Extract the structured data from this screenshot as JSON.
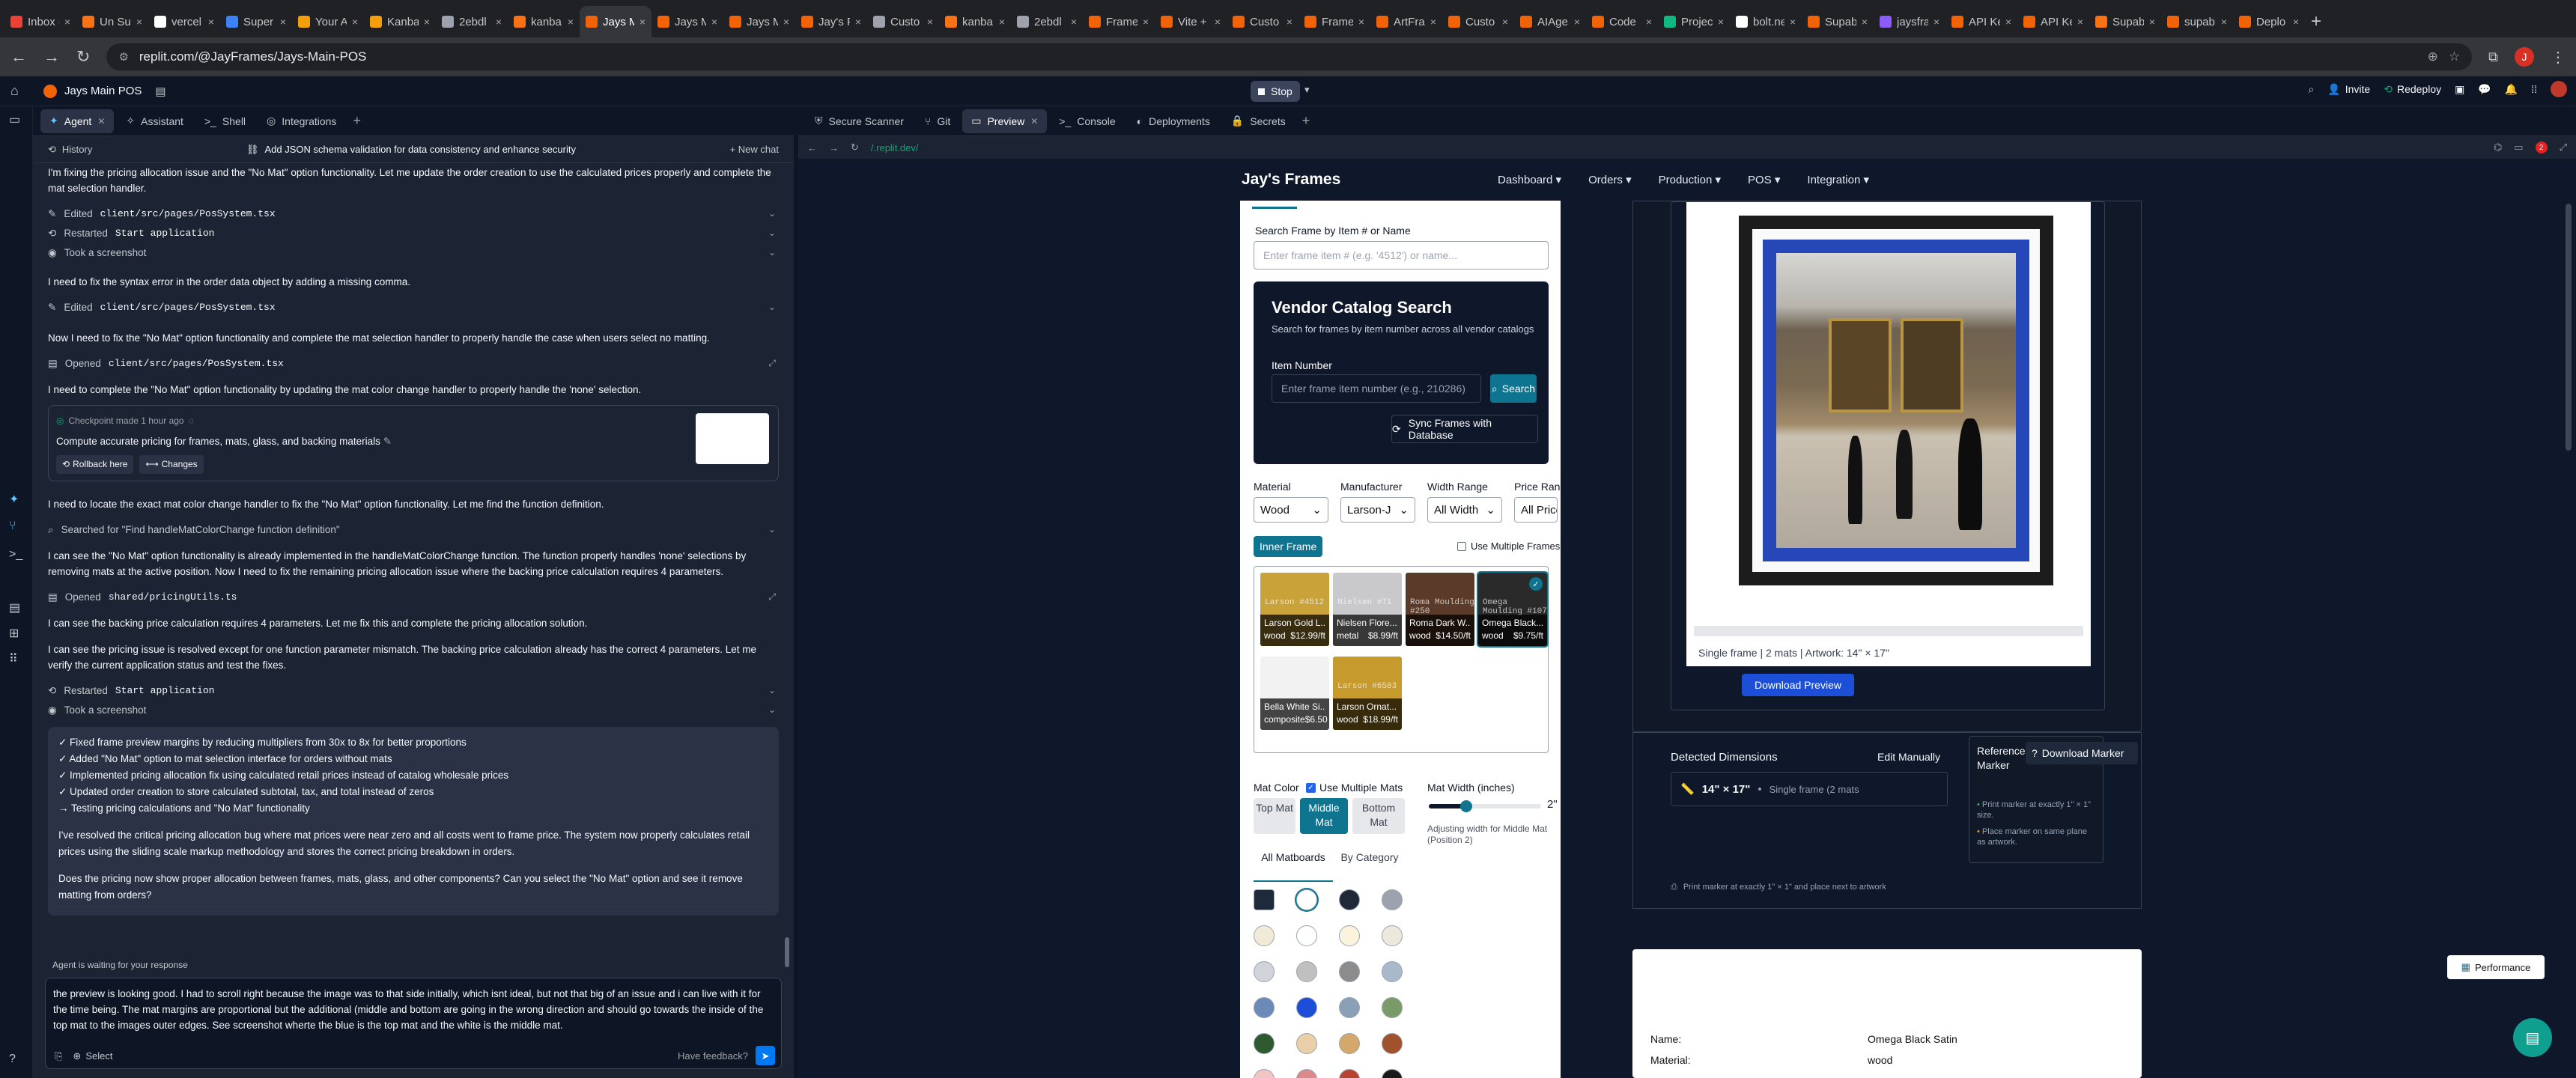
{
  "browser": {
    "tabs": [
      {
        "label": "Inbox (",
        "color": "#ea4335"
      },
      {
        "label": "Un Su",
        "color": "#f97316"
      },
      {
        "label": "vercel",
        "color": "#ffffff"
      },
      {
        "label": "Super",
        "color": "#3b82f6"
      },
      {
        "label": "Your A",
        "color": "#f59e0b"
      },
      {
        "label": "Kanba",
        "color": "#f59e0b"
      },
      {
        "label": "2ebdl",
        "color": "#9ca3af"
      },
      {
        "label": "kanba",
        "color": "#f97316"
      },
      {
        "label": "Jays M",
        "color": "#f26207",
        "active": true
      },
      {
        "label": "Jays M",
        "color": "#f26207"
      },
      {
        "label": "Jays M",
        "color": "#f26207"
      },
      {
        "label": "Jay's F",
        "color": "#f26207"
      },
      {
        "label": "Custo",
        "color": "#9ca3af"
      },
      {
        "label": "kanba",
        "color": "#f97316"
      },
      {
        "label": "2ebdl",
        "color": "#9ca3af"
      },
      {
        "label": "Frame",
        "color": "#f26207"
      },
      {
        "label": "Vite +",
        "color": "#f26207"
      },
      {
        "label": "Custo",
        "color": "#f26207"
      },
      {
        "label": "Frame",
        "color": "#f26207"
      },
      {
        "label": "ArtFra",
        "color": "#f26207"
      },
      {
        "label": "Custo",
        "color": "#f26207"
      },
      {
        "label": "AIAge",
        "color": "#f26207"
      },
      {
        "label": "Code",
        "color": "#f26207"
      },
      {
        "label": "Projec",
        "color": "#10b981"
      },
      {
        "label": "bolt.ne",
        "color": "#ffffff"
      },
      {
        "label": "Supab",
        "color": "#f26207"
      },
      {
        "label": "jaysfra",
        "color": "#8b5cf6"
      },
      {
        "label": "API Ke",
        "color": "#f26207"
      },
      {
        "label": "API Ke",
        "color": "#f26207"
      },
      {
        "label": "Supab",
        "color": "#f97316"
      },
      {
        "label": "supab",
        "color": "#f26207"
      },
      {
        "label": "Deplo",
        "color": "#f26207"
      }
    ],
    "url": "replit.com/@JayFrames/Jays-Main-POS",
    "profile_initial": "J"
  },
  "app": {
    "project_name": "Jays Main POS",
    "stop_label": "Stop",
    "invite_label": "Invite",
    "redeploy_label": "Redeploy"
  },
  "left_tabs": [
    "Agent",
    "Assistant",
    "Shell",
    "Integrations"
  ],
  "history": {
    "label": "History",
    "title": "Add JSON schema validation for data consistency and enhance security",
    "new_chat": "New chat"
  },
  "chat": {
    "intro": "I'm fixing the pricing allocation issue and the \"No Mat\" option functionality. Let me update the order creation to use the calculated prices properly and complete the mat selection handler.",
    "edited1_pre": "Edited",
    "edited1_file": "client/src/pages/PosSystem.tsx",
    "restarted1_pre": "Restarted",
    "restarted1_name": "Start application",
    "screenshot1": "Took a screenshot",
    "msg_syntax": "I need to fix the syntax error in the order data object by adding a missing comma.",
    "edited2_pre": "Edited",
    "edited2_file": "client/src/pages/PosSystem.tsx",
    "msg_nomat": "Now I need to fix the \"No Mat\" option functionality and complete the mat selection handler to properly handle the case when users select no matting.",
    "opened1_pre": "Opened",
    "opened1_file": "client/src/pages/PosSystem.tsx",
    "msg_complete": "I need to complete the \"No Mat\" option functionality by updating the mat color change handler to properly handle the 'none' selection.",
    "checkpoint": {
      "label": "Checkpoint made 1 hour ago",
      "desc": "Compute accurate pricing for frames, mats, glass, and backing materials",
      "rollback": "Rollback here",
      "changes": "Changes"
    },
    "msg_locate": "I need to locate the exact mat color change handler to fix the \"No Mat\" option functionality. Let me find the function definition.",
    "searched": "Searched for \"Find handleMatColorChange function definition\"",
    "msg_seeimpl": "I can see the \"No Mat\" option functionality is already implemented in the handleMatColorChange function. The function properly handles 'none' selections by removing mats at the active position. Now I need to fix the remaining pricing allocation issue where the backing price calculation requires 4 parameters.",
    "opened2_pre": "Opened",
    "opened2_file": "shared/pricingUtils.ts",
    "msg_backing": "I can see the backing price calculation requires 4 parameters. Let me fix this and complete the pricing allocation solution.",
    "msg_resolved": "I can see the pricing issue is resolved except for one function parameter mismatch. The backing price calculation already has the correct 4 parameters. Let me verify the current application status and test the fixes.",
    "restarted2_pre": "Restarted",
    "restarted2_name": "Start application",
    "screenshot2": "Took a screenshot",
    "summary_items": [
      "✓ Fixed frame preview margins by reducing multipliers from 30x to 8x for better proportions",
      "✓ Added \"No Mat\" option to mat selection interface for orders without mats",
      "✓ Implemented pricing allocation fix using calculated retail prices instead of catalog wholesale prices",
      "✓ Updated order creation to store calculated subtotal, tax, and total instead of zeros",
      "→ Testing pricing calculations and \"No Mat\" functionality"
    ],
    "summary_p1": "I've resolved the critical pricing allocation bug where mat prices were near zero and all costs went to frame price. The system now properly calculates retail prices using the sliding scale markup methodology and stores the correct pricing breakdown in orders.",
    "summary_p2": "Does the pricing now show proper allocation between frames, mats, glass, and other components? Can you select the \"No Mat\" option and see it remove matting from orders?",
    "waiting": "Agent is waiting for your response"
  },
  "input": {
    "text": "the preview is looking good. I had to scroll right because the image was to that side initially, which isnt ideal, but not that big of an issue and i can live with it for the time being. The mat margins are proportional but the additional (middle and bottom are going in the wrong direction and should go towards the inside of the top mat to the images outer edges. See screenshot wherte the blue is the top mat and the white is the middle mat.",
    "select_label": "Select",
    "feedback_label": "Have feedback?"
  },
  "right_tabs": [
    "Secure Scanner",
    "Git",
    "Preview",
    "Console",
    "Deployments",
    "Secrets"
  ],
  "preview_url": "/.replit.dev/",
  "site": {
    "brand": "Jay's Frames",
    "nav": [
      "Dashboard ▾",
      "Orders ▾",
      "Production ▾",
      "POS ▾",
      "Integration ▾"
    ],
    "search_label": "Search Frame by Item # or Name",
    "search_placeholder": "Enter frame item # (e.g. '4512') or name...",
    "vendor": {
      "title": "Vendor Catalog Search",
      "subtitle": "Search for frames by item number across all vendor catalogs",
      "item_label": "Item Number",
      "item_placeholder": "Enter frame item number (e.g., 210286)",
      "search_btn": "Search",
      "sync_btn": "Sync Frames with Database"
    },
    "filters": [
      {
        "label": "Material",
        "value": "Wood"
      },
      {
        "label": "Manufacturer",
        "value": "Larson-J"
      },
      {
        "label": "Width Range",
        "value": "All Width"
      },
      {
        "label": "Price Range",
        "value": "All Prices"
      }
    ],
    "inner_frame": "Inner Frame",
    "use_multiple_frames": "Use Multiple Frames",
    "frames": [
      {
        "sku": "Larson #4512",
        "name": "Larson Gold L...",
        "meta": "wood",
        "price": "$12.99/ft",
        "color": "#c9a23a"
      },
      {
        "sku": "Nielsen #71",
        "name": "Nielsen Flore...",
        "meta": "metal",
        "price": "$8.99/ft",
        "color": "#c9c9cb"
      },
      {
        "sku": "Roma Moulding #250",
        "name": "Roma Dark W...",
        "meta": "wood",
        "price": "$14.50/ft",
        "color": "#5a3a28"
      },
      {
        "sku": "Omega Moulding #107",
        "name": "Omega Black...",
        "meta": "wood",
        "price": "$9.75/ft",
        "color": "#2a2a2a",
        "selected": true
      },
      {
        "sku": "",
        "name": "Bella White Si...",
        "meta": "composite",
        "price": "$6.50",
        "color": "#f2f2f2"
      },
      {
        "sku": "Larson #6503",
        "name": "Larson Ornat...",
        "meta": "wood",
        "price": "$18.99/ft",
        "color": "#c79a2e"
      }
    ],
    "mat_color": "Mat Color",
    "use_multiple_mats": "Use Multiple Mats",
    "mat_width_label": "Mat Width (inches)",
    "mat_width_value": "2\"",
    "mat_width_fraction": 0.33,
    "mat_positions": [
      "Top Mat",
      "Middle Mat",
      "Bottom Mat"
    ],
    "mat_active": "Middle Mat",
    "adjusting": "Adjusting width for Middle Mat (Position 2)",
    "mat_tabs": [
      "All Matboards",
      "By Category"
    ],
    "mat_swatches": [
      "#1e293b",
      "#ffffff",
      "#1f2937",
      "#9ca3af",
      "#f1ead6",
      "#ffffff",
      "#fbf3dc",
      "#ece8dc",
      "#d1d5db",
      "#c0c0c0",
      "#8c8c8c",
      "#a8b9cc",
      "#6b8ab8",
      "#1d4ed8",
      "#8aa0b4",
      "#7b9a6a",
      "#2f5a2f",
      "#e8cfa8",
      "#d4a86a",
      "#a0522d",
      "#f3c4c4",
      "#d98a8a",
      "#b5452f",
      "#1a1a1a"
    ],
    "preview": {
      "caption": "Single frame | 2 mats | Artwork: 14\" × 17\"",
      "download": "Download Preview"
    },
    "detected": {
      "label": "Detected Dimensions",
      "edit": "Edit Manually",
      "dims": "14\" × 17\"",
      "dims_sub": "Single frame (2 mats",
      "ref_label": "Reference Marker",
      "download_marker": "Download Marker",
      "tip1": "Print marker at exactly 1\" × 1\" size.",
      "tip2": "Place marker on same plane as artwork.",
      "footer": "Print marker at exactly 1\" × 1\" and place next to artwork"
    },
    "summary": {
      "name_label": "Name:",
      "name_value": "Omega Black Satin",
      "material_label": "Material:",
      "material_value": "wood"
    }
  },
  "performance_label": "Performance"
}
